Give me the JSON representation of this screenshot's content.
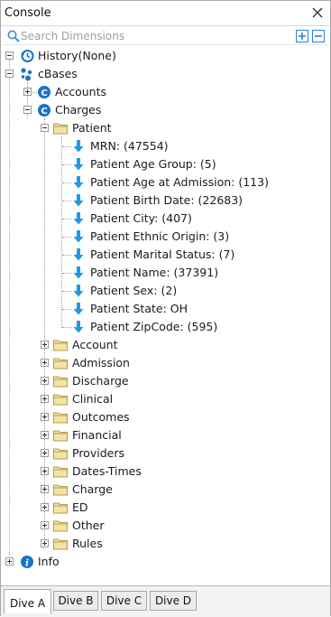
{
  "window": {
    "title": "Console"
  },
  "search": {
    "placeholder": "Search Dimensions"
  },
  "tree": {
    "history": "History(None)",
    "cbases": "cBases",
    "accounts": "Accounts",
    "charges": "Charges",
    "patient": "Patient",
    "patient_fields": [
      "MRN: (47554)",
      "Patient Age Group: (5)",
      "Patient Age at Admission: (113)",
      "Patient Birth Date: (22683)",
      "Patient City: (407)",
      "Patient Ethnic Origin: (3)",
      "Patient Marital Status: (7)",
      "Patient Name: (37391)",
      "Patient Sex: (2)",
      "Patient State: OH",
      "Patient ZipCode: (595)"
    ],
    "folders": [
      "Account",
      "Admission",
      "Discharge",
      "Clinical",
      "Outcomes",
      "Financial",
      "Providers",
      "Dates-Times",
      "Charge",
      "ED",
      "Other",
      "Rules"
    ],
    "info": "Info"
  },
  "tabs": [
    "Dive A",
    "Dive B",
    "Dive C",
    "Dive D"
  ],
  "colors": {
    "accent": "#1a73c8",
    "arrow": "#1e9be0",
    "folder": "#f2e3a6"
  }
}
